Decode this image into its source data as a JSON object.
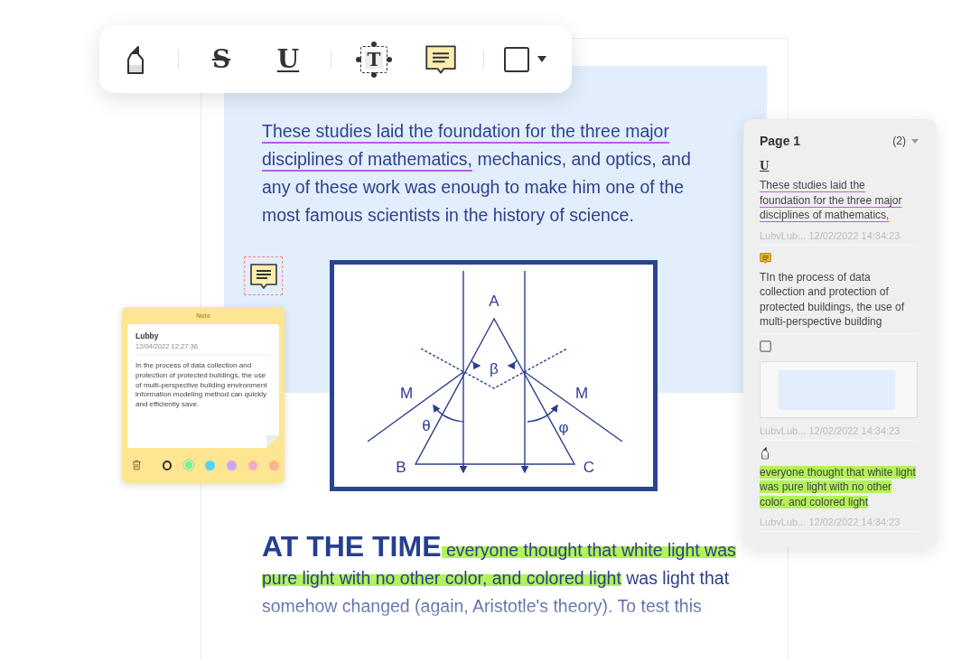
{
  "toolbar": {
    "groups": [
      [
        {
          "kind": "highlighter"
        }
      ],
      [
        {
          "kind": "strikethrough",
          "glyph": "S"
        },
        {
          "kind": "underline",
          "glyph": "U"
        }
      ],
      [
        {
          "kind": "textbox",
          "glyph": "T"
        },
        {
          "kind": "note"
        }
      ],
      [
        {
          "kind": "shape",
          "dropdown": true
        }
      ]
    ]
  },
  "document": {
    "intro": [
      {
        "kind": "underlined",
        "text": "These studies laid the foundation for the three major disciplines of mathematics,"
      },
      {
        "kind": "plain",
        "text": " mechanics, and optics, and any of these work was enough to make him one of the most famous scientists in the history of science."
      }
    ],
    "diagram_labels": [
      "A",
      "β",
      "M",
      "M",
      "θ",
      "φ",
      "B",
      "C"
    ],
    "heading": "AT THE TIME",
    "body": [
      {
        "kind": "highlighted",
        "text": " everyone thought that white light was pure light with no other color, and colored light"
      },
      {
        "kind": "plain",
        "text": " was light that somehow changed (again, Aristotle's theory). To test this"
      }
    ]
  },
  "note": {
    "title": "Note",
    "author": "Lubby",
    "date": "12/04/2022 12:27:36",
    "body": "In the process of data collection and protection of protected buildings, the use of multi-perspective building environment information modeling method can quickly and efficiently save.",
    "swatches": [
      {
        "kind": "outline",
        "color": "#333333",
        "selected": false
      },
      {
        "kind": "fill",
        "color": "#6ff29a",
        "selected": true
      },
      {
        "kind": "fill",
        "color": "#52d3f7",
        "selected": false
      },
      {
        "kind": "fill",
        "color": "#cda6f7",
        "selected": false
      },
      {
        "kind": "fill",
        "color": "#f9a9c9",
        "selected": false
      },
      {
        "kind": "fill",
        "color": "#fbb390",
        "selected": false
      }
    ]
  },
  "panel": {
    "title": "Page 1",
    "count": "(2)",
    "items": [
      {
        "kind": "underline",
        "glyph": "U",
        "text": "These studies laid the foundation for the three major disciplines of mathematics,",
        "meta": "LubvLub... 12/02/2022 14:34:23"
      },
      {
        "kind": "note",
        "text": "TIn the process of data collection and protection of protected buildings, the use of multi-perspective building"
      },
      {
        "kind": "shape",
        "meta": "LubvLub... 12/02/2022 14:34:23"
      },
      {
        "kind": "highlight",
        "text": "everyone thought that white light was pure light with no other color. and colored light",
        "meta": "LubvLub... 12/02/2022 14:34:23"
      }
    ]
  }
}
